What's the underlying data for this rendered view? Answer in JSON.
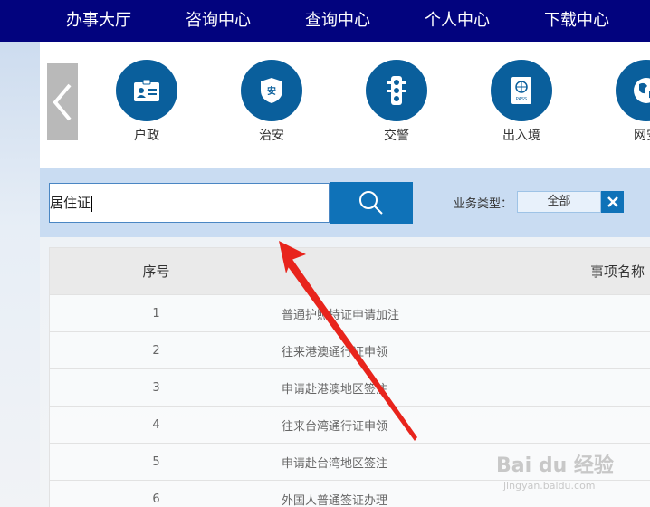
{
  "topnav": {
    "items": [
      {
        "label": "办事大厅"
      },
      {
        "label": "咨询中心"
      },
      {
        "label": "查询中心"
      },
      {
        "label": "个人中心"
      },
      {
        "label": "下载中心"
      }
    ]
  },
  "categories": [
    {
      "label": "户政",
      "icon": "id-card-icon"
    },
    {
      "label": "治安",
      "icon": "shield-icon"
    },
    {
      "label": "交警",
      "icon": "traffic-light-icon"
    },
    {
      "label": "出入境",
      "icon": "passport-icon"
    },
    {
      "label": "网安",
      "icon": "globe-icon"
    }
  ],
  "search": {
    "value": "居住证"
  },
  "filter": {
    "label": "业务类型：",
    "value": "全部"
  },
  "table": {
    "headers": [
      "序号",
      "事项名称"
    ],
    "rows": [
      {
        "num": "1",
        "name": "普通护照持证申请加注"
      },
      {
        "num": "2",
        "name": "往来港澳通行证申领"
      },
      {
        "num": "3",
        "name": "申请赴港澳地区签注"
      },
      {
        "num": "4",
        "name": "往来台湾通行证申领"
      },
      {
        "num": "5",
        "name": "申请赴台湾地区签注"
      },
      {
        "num": "6",
        "name": "外国人普通签证办理"
      }
    ]
  },
  "watermark": {
    "text": "Bai du 经验",
    "sub": "jingyan.baidu.com"
  },
  "colors": {
    "nav_bg": "#02037e",
    "icon_circle": "#0a5f9c",
    "search_button": "#0f72b8",
    "annotation_arrow": "#e8241c"
  }
}
